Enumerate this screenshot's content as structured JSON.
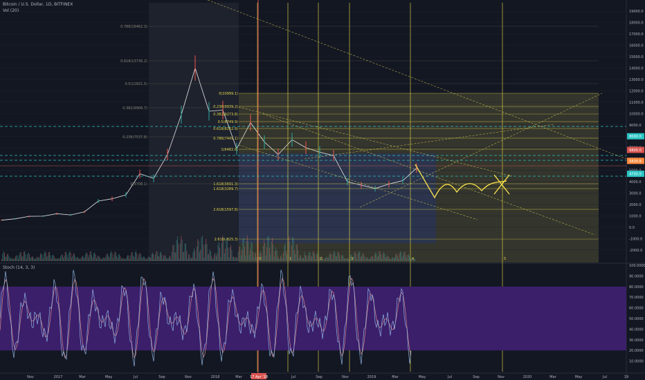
{
  "header": {
    "symbol": "Bitcoin / U.S. Dollar, 1D, BITFINEX",
    "volume": "Vol (20)",
    "stoch": "Stoch (14, 3, 3)"
  },
  "price_axis_labels": [
    "19000.0",
    "18000.0",
    "17000.0",
    "16000.0",
    "15000.0",
    "14000.0",
    "13000.0",
    "12000.0",
    "11000.0",
    "10000.0",
    "9000.0",
    "8000.0",
    "7000.0",
    "6000.0",
    "5000.0",
    "4000.0",
    "3000.0",
    "2000.0",
    "1000.0",
    "0.0",
    "-1000.0",
    "-2000.0"
  ],
  "stoch_axis_labels": [
    "100.0000",
    "90.0000",
    "80.0000",
    "70.0000",
    "60.0000",
    "50.0000",
    "40.0000",
    "30.0000",
    "20.0000",
    "10.0000"
  ],
  "time_axis_labels": [
    "Nov",
    "2017",
    "Mar",
    "May",
    "Jul",
    "Sep",
    "Nov",
    "2018",
    "Mar",
    "17 Apr '18",
    "Jul",
    "Sep",
    "Nov",
    "2019",
    "Mar",
    "May",
    "Jul",
    "Sep",
    "Nov",
    "2020",
    "Mar",
    "May",
    "Jul",
    "19"
  ],
  "price_boxes": [
    "8000.0",
    "6800.0",
    "5834.8",
    "4700.0"
  ],
  "fib_left": [
    "0.786(16462.3)",
    "0.618(13736.2)",
    "0.5(11821.5)",
    "0.382(9906.7)",
    "0.236(7537.8)",
    "0(3708.1)"
  ],
  "fib_right": [
    "0(10999.1)",
    "0.236(9939.2)",
    "0.382(9273.8)",
    "0.5(8749.9)",
    "0.618(8262.9)",
    "0.786(7449.1)",
    "1(6482.6)",
    "1.618(3691.3)",
    "1.618(3289.7)",
    "2.618(1597.8)",
    "2.618(-825.3)"
  ],
  "chart_data": {
    "type": "candlestick",
    "title": "Bitcoin / U.S. Dollar, 1D, BITFINEX",
    "x": [
      "2016-10",
      "2016-11",
      "2016-12",
      "2017-01",
      "2017-02",
      "2017-03",
      "2017-04",
      "2017-05",
      "2017-06",
      "2017-07",
      "2017-08",
      "2017-09",
      "2017-10",
      "2017-11",
      "2017-12",
      "2018-01",
      "2018-02",
      "2018-03",
      "2018-04",
      "2018-05",
      "2018-06",
      "2018-07",
      "2018-08",
      "2018-09",
      "2018-10",
      "2018-11",
      "2018-12",
      "2019-01",
      "2019-02",
      "2019-03",
      "2019-04"
    ],
    "close": [
      620,
      740,
      960,
      970,
      1190,
      1080,
      1350,
      2300,
      2500,
      2850,
      4700,
      4300,
      6400,
      9900,
      14000,
      10200,
      10300,
      6900,
      9200,
      7500,
      6400,
      7700,
      7000,
      6600,
      6300,
      4000,
      3700,
      3400,
      3800,
      4100,
      5200
    ],
    "ylim": [
      -2500,
      19500
    ],
    "stoch_ylim": [
      0,
      100
    ],
    "stoch_band": [
      20,
      80
    ],
    "annotations": [
      "0",
      "1",
      "2",
      "3",
      "4",
      "5"
    ]
  }
}
